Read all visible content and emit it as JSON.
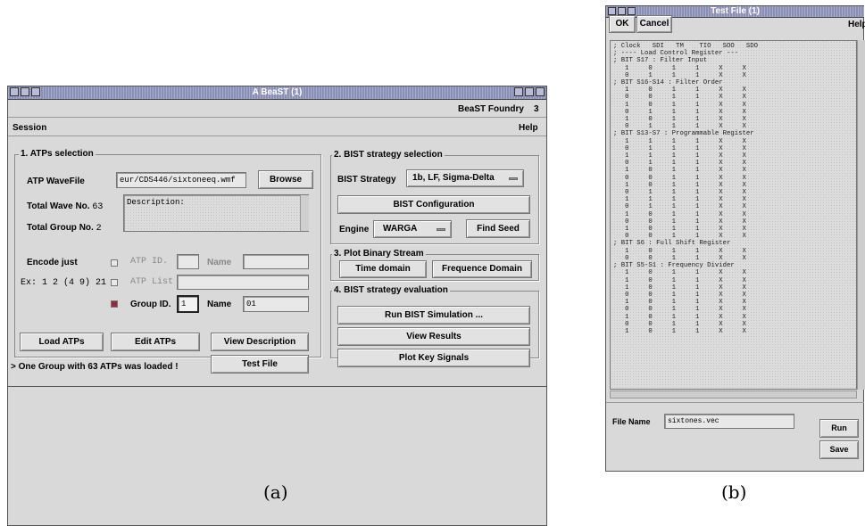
{
  "captions": {
    "a": "(a)",
    "b": "(b)"
  },
  "beast": {
    "title": "A BeaST (1)",
    "brand": "BeaST Foundry",
    "brand_num": "3",
    "menu": {
      "session": "Session",
      "help": "Help"
    },
    "atp": {
      "group_title": "1. ATPs selection",
      "wavefile_label": "ATP WaveFile",
      "wavefile_value": "eur/CDS446/sixtoneeq.wmf",
      "browse": "Browse",
      "total_wave_label": "Total Wave No.",
      "total_wave_value": "63",
      "total_group_label": "Total Group No.",
      "total_group_value": "2",
      "description": "Description:",
      "encode_just": "Encode just",
      "atp_id": "ATP ID.",
      "name_label": "Name",
      "ex_label": "Ex: 1 2 (4 9) 21",
      "atp_list": "ATP List",
      "group_id_label": "Group ID.",
      "group_id_value": "1",
      "name_value": "01",
      "load_atps": "Load ATPs",
      "edit_atps": "Edit ATPs",
      "view_description": "View Description",
      "test_file": "Test File"
    },
    "bist": {
      "group_title": "2. BIST strategy selection",
      "strategy_label": "BIST Strategy",
      "strategy_value": "1b, LF, Sigma-Delta",
      "config": "BIST Configuration",
      "engine_label": "Engine",
      "engine_value": "WARGA",
      "find_seed": "Find Seed"
    },
    "plot": {
      "group_title": "3. Plot Binary Stream",
      "time_domain": "Time domain",
      "freq_domain": "Frequence Domain"
    },
    "eval": {
      "group_title": "4. BIST strategy evaluation",
      "run": "Run BIST Simulation ...",
      "view_results": "View Results",
      "plot_key": "Plot Key Signals"
    },
    "status": "> One Group with 63 ATPs was loaded !"
  },
  "testfile": {
    "title": "Test File (1)",
    "ok": "OK",
    "cancel": "Cancel",
    "help": "Help",
    "content": "; Clock   SDI   TM    TIO   SOO   SDO\n; ---- Load Control Register ---\n; BIT S17 : Filter Input\n   1     0     1     1     X     X\n   0     1     1     1     X     X\n; BIT S16-S14 : Filter Order\n   1     0     1     1     X     X\n   0     0     1     1     X     X\n   1     0     1     1     X     X\n   0     1     1     1     X     X\n   1     0     1     1     X     X\n   0     1     1     1     X     X\n; BIT S13-S7 : Programmable Register\n   1     1     1     1     X     X\n   0     1     1     1     X     X\n   1     1     1     1     X     X\n   0     1     1     1     X     X\n   1     0     1     1     X     X\n   0     0     1     1     X     X\n   1     0     1     1     X     X\n   0     1     1     1     X     X\n   1     1     1     1     X     X\n   0     1     1     1     X     X\n   1     0     1     1     X     X\n   0     0     1     1     X     X\n   1     0     1     1     X     X\n   0     0     1     1     X     X\n; BIT S6 : Full Shift Register\n   1     0     1     1     X     X\n   0     0     1     1     X     X\n; BIT S5-S1 : Frequency Divider\n   1     0     1     1     X     X\n   1     0     1     1     X     X\n   1     0     1     1     X     X\n   0     0     1     1     X     X\n   1     0     1     1     X     X\n   0     0     1     1     X     X\n   1     0     1     1     X     X\n   0     0     1     1     X     X\n   1     0     1     1     X     X",
    "file_name_label": "File Name",
    "file_name_value": "sixtones.vec",
    "run": "Run",
    "save": "Save"
  }
}
